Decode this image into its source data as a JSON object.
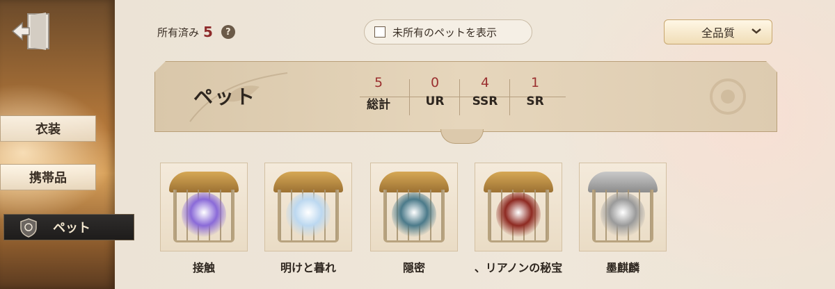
{
  "sidebar": {
    "items": [
      {
        "label": "衣装"
      },
      {
        "label": "携帯品"
      },
      {
        "label": "ペット"
      }
    ],
    "active_index": 2
  },
  "header": {
    "owned_label": "所有済み",
    "owned_count": "5",
    "help_icon": "?",
    "toggle_label": "未所有のペットを表示",
    "toggle_checked": false,
    "quality_filter": "全品質"
  },
  "banner": {
    "title": "ペット",
    "stats": [
      {
        "value": "5",
        "label": "総計"
      },
      {
        "value": "0",
        "label": "UR"
      },
      {
        "value": "4",
        "label": "SSR"
      },
      {
        "value": "1",
        "label": "SR"
      }
    ]
  },
  "pets": [
    {
      "name": "接触",
      "color": "#8a6ad8"
    },
    {
      "name": "明けと暮れ",
      "color": "#bcd8f0"
    },
    {
      "name": "隠密",
      "color": "#4b7a8a"
    },
    {
      "name": "、リアノンの秘宝",
      "color": "#8e2a22"
    },
    {
      "name": "墨麒麟",
      "color": "#9a9a9a"
    }
  ],
  "colors": {
    "accent_red": "#9b3030",
    "active_nav": "#1e1c1b"
  }
}
